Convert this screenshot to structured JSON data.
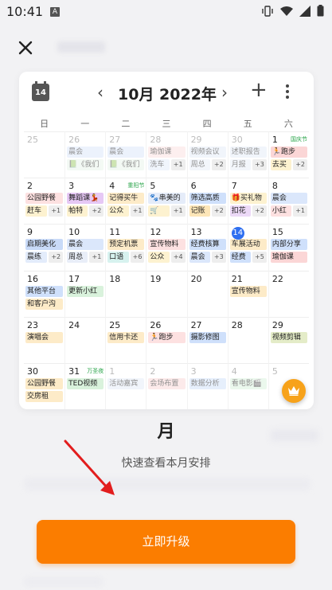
{
  "status": {
    "time": "10:41",
    "a_icon": "A"
  },
  "header": {
    "close_icon": "close-icon"
  },
  "calendar": {
    "icon_day": "14",
    "title": "10月 2022年",
    "prev": "‹",
    "next": "›",
    "add": "+",
    "weekdays": [
      "日",
      "一",
      "二",
      "三",
      "四",
      "五",
      "六"
    ],
    "weeks": [
      [
        {
          "day": "25",
          "dim": true,
          "events": []
        },
        {
          "day": "26",
          "dim": true,
          "events": [
            {
              "t": "晨会",
              "c": "#dbe7fb"
            },
            {
              "t": "📗《我们",
              "c": "#e9f5ea"
            }
          ]
        },
        {
          "day": "27",
          "dim": true,
          "events": [
            {
              "t": "晨会",
              "c": "#dbe7fb"
            },
            {
              "t": "📗《我们",
              "c": "#e9f5ea"
            }
          ]
        },
        {
          "day": "28",
          "dim": true,
          "events": [
            {
              "t": "瑜伽课",
              "c": "#fde1e1"
            },
            {
              "t": "洗车",
              "c": "#e3ecfb"
            },
            {
              "t": "+1",
              "plus": true
            }
          ]
        },
        {
          "day": "29",
          "dim": true,
          "events": [
            {
              "t": "视频会议",
              "c": "#e5ecf9"
            },
            {
              "t": "周总",
              "c": "#e9eef8"
            },
            {
              "t": "+2",
              "plus": true
            }
          ]
        },
        {
          "day": "30",
          "dim": true,
          "events": [
            {
              "t": "述职报告",
              "c": "#e5ecf9"
            },
            {
              "t": "月报",
              "c": "#e9eef8"
            },
            {
              "t": "+3",
              "plus": true
            }
          ]
        },
        {
          "day": "1",
          "holiday": "国庆节",
          "events": [
            {
              "t": "🏃跑步",
              "c": "#fbd6d6"
            },
            {
              "t": "去买",
              "c": "#fdf2d0"
            },
            {
              "t": "+2",
              "plus": true
            }
          ]
        }
      ],
      [
        {
          "day": "2",
          "events": [
            {
              "t": "公园野餐",
              "c": "#fde1e1"
            },
            {
              "t": "赶车",
              "c": "#fdf2d0"
            },
            {
              "t": "+1",
              "plus": true
            }
          ]
        },
        {
          "day": "3",
          "events": [
            {
              "t": "舞蹈课💃",
              "c": "#e6c8f5"
            },
            {
              "t": "帕特",
              "c": "#fdf2d0"
            },
            {
              "t": "+2",
              "plus": true
            }
          ]
        },
        {
          "day": "4",
          "holiday": "重阳节",
          "events": [
            {
              "t": "记得买牛",
              "c": "#fdebc8"
            },
            {
              "t": "公众",
              "c": "#fdf2d0"
            },
            {
              "t": "+1",
              "plus": true
            }
          ]
        },
        {
          "day": "5",
          "events": [
            {
              "t": "🐾串美的",
              "c": "#e5ecf9"
            },
            {
              "t": "🛒",
              "c": "#fdf2d0"
            },
            {
              "t": "+1",
              "plus": true
            }
          ]
        },
        {
          "day": "6",
          "events": [
            {
              "t": "筛选高质",
              "c": "#cfe0fb"
            },
            {
              "t": "记账",
              "c": "#fde6b8"
            },
            {
              "t": "+2",
              "plus": true
            }
          ]
        },
        {
          "day": "7",
          "events": [
            {
              "t": "🎁买礼物",
              "c": "#fdf2d0"
            },
            {
              "t": "扣花",
              "c": "#ecd9f7"
            },
            {
              "t": "+2",
              "plus": true
            }
          ]
        },
        {
          "day": "8",
          "events": [
            {
              "t": "晨会",
              "c": "#dbe7fb"
            },
            {
              "t": "小红",
              "c": "#fde1e1"
            },
            {
              "t": "+1",
              "plus": true
            }
          ]
        }
      ],
      [
        {
          "day": "9",
          "events": [
            {
              "t": "启期美化",
              "c": "#c8daf8"
            },
            {
              "t": "晨练",
              "c": "#e3ecfb"
            },
            {
              "t": "+2",
              "plus": true
            }
          ]
        },
        {
          "day": "10",
          "events": [
            {
              "t": "晨会",
              "c": "#dbe7fb"
            },
            {
              "t": "周总",
              "c": "#e9eef8"
            },
            {
              "t": "+1",
              "plus": true
            }
          ]
        },
        {
          "day": "11",
          "events": [
            {
              "t": "预定机票",
              "c": "#fdebc8"
            },
            {
              "t": "口语",
              "c": "#d7f2ef"
            },
            {
              "t": "+6",
              "plus": true
            }
          ]
        },
        {
          "day": "12",
          "events": [
            {
              "t": "宣传物料",
              "c": "#fde1e1"
            },
            {
              "t": "公众",
              "c": "#fdf2d0"
            },
            {
              "t": "+4",
              "plus": true
            }
          ]
        },
        {
          "day": "13",
          "events": [
            {
              "t": "经费核算",
              "c": "#cfe0fb"
            },
            {
              "t": "晨会",
              "c": "#dbe7fb"
            },
            {
              "t": "+3",
              "plus": true
            }
          ]
        },
        {
          "day": "14",
          "today": true,
          "events": [
            {
              "t": "车展活动",
              "c": "#fdebc8"
            },
            {
              "t": "经费",
              "c": "#cfe0fb"
            },
            {
              "t": "+5",
              "plus": true
            }
          ]
        },
        {
          "day": "15",
          "events": [
            {
              "t": "内部分享",
              "c": "#cfe0fb"
            },
            {
              "t": "瑜伽课",
              "c": "#fbd6d6"
            }
          ]
        }
      ],
      [
        {
          "day": "16",
          "events": [
            {
              "t": "其他平台",
              "c": "#cfe0fb"
            },
            {
              "t": "和客户沟",
              "c": "#fdebc8"
            }
          ]
        },
        {
          "day": "17",
          "events": [
            {
              "t": "更新小红",
              "c": "#d9f2dc"
            }
          ]
        },
        {
          "day": "18",
          "events": []
        },
        {
          "day": "19",
          "events": []
        },
        {
          "day": "20",
          "events": []
        },
        {
          "day": "21",
          "events": [
            {
              "t": "宣传物料",
              "c": "#fdebc8"
            }
          ]
        },
        {
          "day": "22",
          "events": []
        }
      ],
      [
        {
          "day": "23",
          "events": [
            {
              "t": "演唱会",
              "c": "#fdebc8"
            }
          ]
        },
        {
          "day": "24",
          "events": []
        },
        {
          "day": "25",
          "events": [
            {
              "t": "信用卡还",
              "c": "#fdebc8"
            }
          ]
        },
        {
          "day": "26",
          "events": [
            {
              "t": "🏃跑步",
              "c": "#fde1e1"
            }
          ]
        },
        {
          "day": "27",
          "events": [
            {
              "t": "摄影修图",
              "c": "#cfe0fb"
            }
          ]
        },
        {
          "day": "28",
          "events": []
        },
        {
          "day": "29",
          "events": [
            {
              "t": "视频剪辑",
              "c": "#e4ecc8"
            }
          ]
        }
      ],
      [
        {
          "day": "30",
          "events": [
            {
              "t": "公园野餐",
              "c": "#fdebc8"
            },
            {
              "t": "交房租",
              "c": "#fdebc8"
            }
          ]
        },
        {
          "day": "31",
          "holiday": "万圣夜",
          "events": [
            {
              "t": "TED视频",
              "c": "#d9f2dc"
            }
          ]
        },
        {
          "day": "1",
          "dim": true,
          "events": [
            {
              "t": "活动嘉宾",
              "c": "#e5ecf9"
            }
          ]
        },
        {
          "day": "2",
          "dim": true,
          "events": [
            {
              "t": "会场布置",
              "c": "#fbd6d6"
            }
          ]
        },
        {
          "day": "3",
          "dim": true,
          "events": [
            {
              "t": "数据分析",
              "c": "#cfe0fb"
            }
          ]
        },
        {
          "day": "4",
          "dim": true,
          "events": [
            {
              "t": "看电影🎬",
              "c": "#d9f2dc"
            }
          ]
        },
        {
          "day": "5",
          "dim": true,
          "events": []
        }
      ]
    ]
  },
  "feature": {
    "title": "月",
    "description": "快速查看本月安排"
  },
  "cta": {
    "label": "立即升级"
  },
  "colors": {
    "accent": "#fb7d00",
    "today": "#2e6ff0",
    "crown": "#f7a21a"
  }
}
